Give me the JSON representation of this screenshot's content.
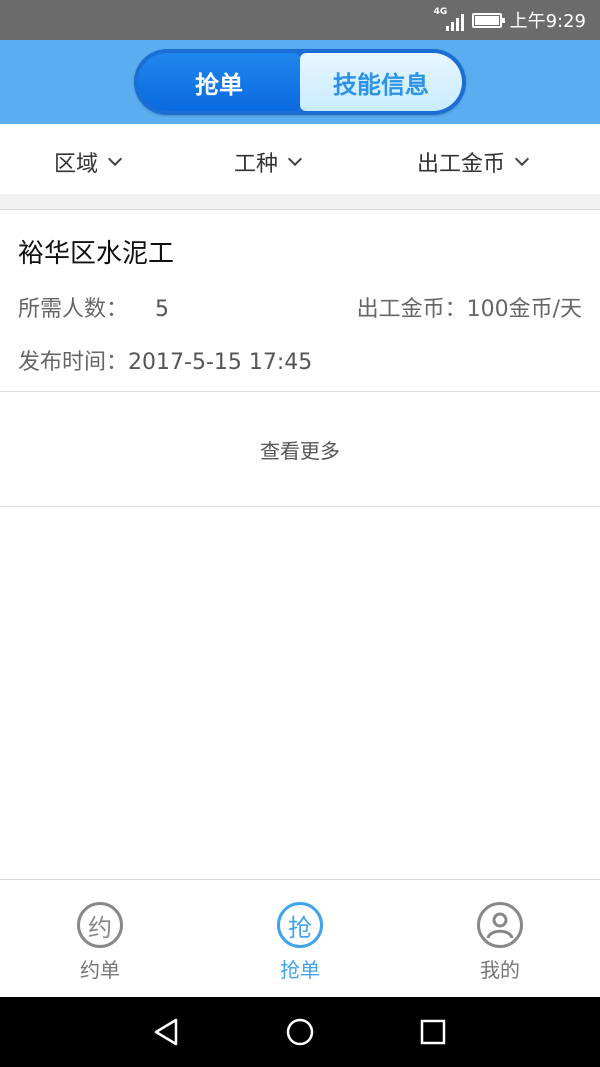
{
  "status_bar": {
    "network": "4G",
    "time": "上午9:29"
  },
  "header": {
    "tabs": [
      {
        "label": "抢单",
        "active": true
      },
      {
        "label": "技能信息",
        "active": false
      }
    ]
  },
  "filters": [
    {
      "label": "区域"
    },
    {
      "label": "工种"
    },
    {
      "label": "出工金币"
    }
  ],
  "job": {
    "title": "裕华区水泥工",
    "people_label": "所需人数：",
    "people_value": "5",
    "pay_label": "出工金币：",
    "pay_value": "100金币/天",
    "time_label": "发布时间：",
    "time_value": "2017-5-15 17:45"
  },
  "more_label": "查看更多",
  "bottom_nav": [
    {
      "label": "约单",
      "icon_char": "约",
      "icon": "appointment-icon",
      "active": false
    },
    {
      "label": "抢单",
      "icon_char": "抢",
      "icon": "grab-order-icon",
      "active": true
    },
    {
      "label": "我的",
      "icon": "profile-icon",
      "active": false
    }
  ],
  "colors": {
    "header_bg": "#5aaeef",
    "accent": "#3fa3ee",
    "segment_active": "#0a6ae0"
  }
}
